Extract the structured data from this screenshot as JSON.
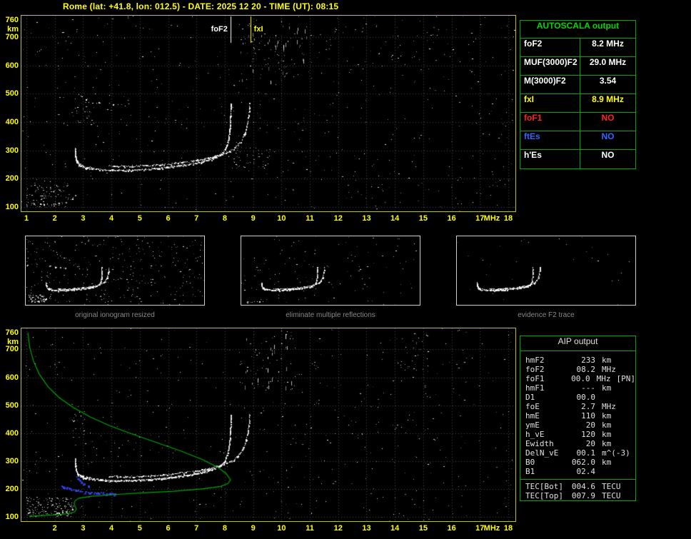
{
  "header": {
    "title": "Rome (lat: +41.8, lon: 012.5) - DATE: 2025 12 20 - TIME (UT): 08:15"
  },
  "colors": {
    "background": "#000000",
    "title_text": "#ffff00",
    "plot_frame": "#c0c020",
    "axis_labels": "#ffff00",
    "grid": "#4a4a4a",
    "trace": "#ffffff",
    "restored_trace": "#3344ee",
    "profile_line": "#00a800",
    "table_border": "#00aa00",
    "autoscala_title": "#00d800",
    "value_yellow": "#ffff00",
    "value_red": "#ff2222",
    "value_blue": "#3366ff",
    "caption_text": "#8a8a8a"
  },
  "autoscala": {
    "title": "AUTOSCALA output",
    "rows": [
      {
        "label": "foF2",
        "value": "8.2 MHz",
        "color": "#ffffff"
      },
      {
        "label": "MUF(3000)F2",
        "value": "29.0 MHz",
        "color": "#ffffff"
      },
      {
        "label": "M(3000)F2",
        "value": "3.54",
        "color": "#ffffff"
      },
      {
        "label": "fxI",
        "value": "8.9 MHz",
        "color": "#ffff00"
      },
      {
        "label": "foF1",
        "value": "NO",
        "color": "#ff2222"
      },
      {
        "label": "ftEs",
        "value": "NO",
        "color": "#3366ff"
      },
      {
        "label": "h'Es",
        "value": "NO",
        "color": "#ffffff"
      }
    ]
  },
  "aip": {
    "title": "AIP output",
    "rows": [
      {
        "label": "hmF2",
        "value": "233",
        "unit": "km",
        "note": ""
      },
      {
        "label": "foF2",
        "value": "08.2",
        "unit": "MHz",
        "note": ""
      },
      {
        "label": "foF1",
        "value": "00.0",
        "unit": "MHz",
        "note": "[PN]"
      },
      {
        "label": "hmF1",
        "value": "---",
        "unit": "km",
        "note": ""
      },
      {
        "label": "D1",
        "value": "00.0",
        "unit": "",
        "note": ""
      },
      {
        "label": "foE",
        "value": "2.7",
        "unit": "MHz",
        "note": ""
      },
      {
        "label": "hmE",
        "value": "110",
        "unit": "km",
        "note": ""
      },
      {
        "label": "ymE",
        "value": "20",
        "unit": "km",
        "note": ""
      },
      {
        "label": "h_vE",
        "value": "120",
        "unit": "km",
        "note": ""
      },
      {
        "label": "Ewidth",
        "value": "20",
        "unit": "km",
        "note": ""
      },
      {
        "label": "DelN_vE",
        "value": "00.1",
        "unit": "m^(-3)",
        "note": ""
      },
      {
        "label": "B0",
        "value": "062.0",
        "unit": "km",
        "note": ""
      },
      {
        "label": "B1",
        "value": "02.4",
        "unit": "",
        "note": ""
      }
    ],
    "tec_rows": [
      {
        "label": "TEC[Bot]",
        "value": "004.6",
        "unit": "TECU"
      },
      {
        "label": "TEC[Top]",
        "value": "007.9",
        "unit": "TECU"
      }
    ]
  },
  "thumbnails": [
    {
      "caption": "original ionogram resized",
      "noise": 340,
      "series": [
        0,
        1,
        2,
        3,
        4
      ],
      "seed": 11
    },
    {
      "caption": "eliminate multiple reflections",
      "noise": 120,
      "series": [
        0,
        1,
        2,
        3
      ],
      "seed": 12
    },
    {
      "caption": "evidence F2 trace",
      "noise": 28,
      "series": [
        1,
        2,
        3
      ],
      "seed": 13
    }
  ],
  "chart_data": [
    {
      "type": "scatter",
      "title": "ionogram with autoscaled characteristics",
      "xlabel": "MHz",
      "ylabel": "km",
      "xlim": [
        1,
        18
      ],
      "ylim": [
        100,
        760
      ],
      "x_ticks": [
        1,
        2,
        3,
        4,
        5,
        6,
        7,
        8,
        9,
        10,
        11,
        12,
        13,
        14,
        15,
        16,
        17,
        18
      ],
      "x_gridlines": [
        1,
        2,
        3,
        4,
        5,
        6,
        7,
        8,
        9,
        10,
        11,
        12,
        13,
        14,
        15,
        16,
        17,
        18
      ],
      "y_ticks": [
        760,
        700,
        600,
        500,
        400,
        300,
        200,
        100
      ],
      "y_gridlines": [
        100,
        200,
        300,
        400,
        500,
        600,
        700
      ],
      "grid": true,
      "noise": 560,
      "seed": 7,
      "noise_clusters": [
        {
          "x": [
            8.5,
            10.9
          ],
          "y": [
            540,
            760
          ],
          "n": 90,
          "streaks": true
        },
        {
          "x": [
            1.0,
            2.5
          ],
          "y": [
            100,
            185
          ],
          "n": 90
        },
        {
          "x": [
            8.3,
            9.6
          ],
          "y": [
            225,
            310
          ],
          "n": 45
        },
        {
          "x": [
            2.6,
            3.4
          ],
          "y": [
            390,
            520
          ],
          "n": 25
        },
        {
          "x": [
            11.0,
            16.8
          ],
          "y": [
            600,
            760
          ],
          "n": 40
        }
      ],
      "markers": [
        {
          "label": "foF2",
          "freq": 8.2,
          "color": "#ffffff",
          "label_side": "left",
          "line_length": 38
        },
        {
          "label": "fxI",
          "freq": 8.9,
          "color": "#ffff00",
          "label_side": "right",
          "line_length": 38
        }
      ],
      "series": [
        {
          "name": "E-trace",
          "color": "#ffffff",
          "density": 0.5,
          "keep": 0.55,
          "jitter": 1.2,
          "points": [
            [
              1.05,
              118
            ],
            [
              1.3,
              113
            ],
            [
              1.6,
              111
            ],
            [
              1.95,
              112
            ],
            [
              2.25,
              115
            ],
            [
              2.5,
              121
            ],
            [
              2.62,
              130
            ],
            [
              2.7,
              142
            ]
          ]
        },
        {
          "name": "F-cusp",
          "color": "#ffffff",
          "density": 3,
          "keep": 0.95,
          "jitter": 2.2,
          "points": [
            [
              2.7,
              305
            ],
            [
              2.72,
              283
            ],
            [
              2.76,
              262
            ],
            [
              2.84,
              250
            ],
            [
              3.0,
              243
            ],
            [
              3.25,
              238
            ]
          ]
        },
        {
          "name": "F2-ordinary-trace",
          "color": "#ffffff",
          "density": 1.6,
          "keep": 0.93,
          "jitter": 1.1,
          "points": [
            [
              3.25,
              238
            ],
            [
              3.7,
              232
            ],
            [
              4.2,
              230
            ],
            [
              4.8,
              231
            ],
            [
              5.4,
              235
            ],
            [
              6.0,
              241
            ],
            [
              6.6,
              249
            ],
            [
              7.1,
              258
            ],
            [
              7.5,
              269
            ],
            [
              7.8,
              283
            ],
            [
              8.0,
              302
            ],
            [
              8.1,
              330
            ],
            [
              8.16,
              368
            ],
            [
              8.19,
              420
            ],
            [
              8.2,
              468
            ]
          ]
        },
        {
          "name": "F2-extraordinary-trace",
          "color": "#ffffff",
          "density": 1.3,
          "keep": 0.9,
          "jitter": 1.1,
          "points": [
            [
              3.9,
              247
            ],
            [
              4.5,
              244
            ],
            [
              5.1,
              246
            ],
            [
              5.7,
              250
            ],
            [
              6.3,
              256
            ],
            [
              6.9,
              264
            ],
            [
              7.4,
              273
            ],
            [
              7.9,
              287
            ],
            [
              8.3,
              305
            ],
            [
              8.55,
              330
            ],
            [
              8.7,
              360
            ],
            [
              8.8,
              400
            ],
            [
              8.85,
              440
            ],
            [
              8.87,
              468
            ]
          ]
        },
        {
          "name": "second-hop-multiple",
          "color": "#ffffff",
          "density": 0.5,
          "keep": 0.45,
          "jitter": 1.6,
          "points": [
            [
              2.85,
              495
            ],
            [
              3.2,
              474
            ],
            [
              3.6,
              466
            ],
            [
              4.1,
              462
            ],
            [
              4.6,
              463
            ]
          ]
        }
      ]
    },
    {
      "type": "scatter",
      "title": "restored ionogram with electron density profile",
      "xlabel": "MHz",
      "ylabel": "km",
      "xlim": [
        1,
        18
      ],
      "ylim": [
        100,
        760
      ],
      "x_ticks": [
        2,
        3,
        4,
        5,
        6,
        7,
        8,
        9,
        10,
        11,
        12,
        13,
        14,
        15,
        16,
        17,
        18
      ],
      "x_gridlines": [
        1,
        2,
        3,
        4,
        5,
        6,
        7,
        8,
        9,
        10,
        11,
        12,
        13,
        14,
        15,
        16,
        17,
        18
      ],
      "y_ticks": [
        760,
        700,
        600,
        500,
        400,
        300,
        200,
        100
      ],
      "y_gridlines": [
        100,
        200,
        300,
        400,
        500,
        600,
        700
      ],
      "grid": true,
      "noise": 520,
      "seed": 21,
      "noise_clusters": [
        {
          "x": [
            1.0,
            2.6
          ],
          "y": [
            100,
            172
          ],
          "n": 150
        },
        {
          "x": [
            8.5,
            10.6
          ],
          "y": [
            560,
            760
          ],
          "n": 55,
          "streaks": true
        },
        {
          "x": [
            2.6,
            3.1
          ],
          "y": [
            380,
            480
          ],
          "n": 18
        },
        {
          "x": [
            14.2,
            15.3
          ],
          "y": [
            620,
            760
          ],
          "n": 20
        }
      ],
      "markers": [],
      "series": [
        {
          "name": "E-trace",
          "color": "#ffffff",
          "density": 0.5,
          "keep": 0.55,
          "jitter": 1.2,
          "points": [
            [
              1.05,
              118
            ],
            [
              1.3,
              113
            ],
            [
              1.6,
              111
            ],
            [
              1.95,
              112
            ],
            [
              2.25,
              115
            ],
            [
              2.5,
              121
            ],
            [
              2.62,
              130
            ],
            [
              2.7,
              142
            ]
          ]
        },
        {
          "name": "F-cusp",
          "color": "#ffffff",
          "density": 3,
          "keep": 0.95,
          "jitter": 2.2,
          "points": [
            [
              2.7,
              305
            ],
            [
              2.72,
              283
            ],
            [
              2.76,
              262
            ],
            [
              2.84,
              250
            ],
            [
              3.0,
              243
            ],
            [
              3.25,
              238
            ]
          ]
        },
        {
          "name": "F2-ordinary-trace",
          "color": "#ffffff",
          "density": 2,
          "keep": 0.95,
          "jitter": 1.1,
          "points": [
            [
              3.25,
              238
            ],
            [
              3.7,
              232
            ],
            [
              4.2,
              230
            ],
            [
              4.8,
              231
            ],
            [
              5.4,
              235
            ],
            [
              6.0,
              241
            ],
            [
              6.6,
              249
            ],
            [
              7.1,
              258
            ],
            [
              7.5,
              269
            ],
            [
              7.8,
              283
            ],
            [
              8.0,
              302
            ],
            [
              8.1,
              330
            ],
            [
              8.16,
              368
            ],
            [
              8.19,
              420
            ],
            [
              8.2,
              468
            ]
          ]
        },
        {
          "name": "F2-extraordinary-trace",
          "color": "#ffffff",
          "density": 1.3,
          "keep": 0.9,
          "jitter": 1.1,
          "points": [
            [
              3.9,
              247
            ],
            [
              4.5,
              244
            ],
            [
              5.1,
              246
            ],
            [
              5.7,
              250
            ],
            [
              6.3,
              256
            ],
            [
              6.9,
              264
            ],
            [
              7.4,
              273
            ],
            [
              7.9,
              287
            ],
            [
              8.3,
              305
            ],
            [
              8.55,
              330
            ],
            [
              8.7,
              360
            ],
            [
              8.8,
              400
            ],
            [
              8.85,
              440
            ],
            [
              8.87,
              468
            ]
          ]
        },
        {
          "name": "restored-trace-blue",
          "color": "#3344ee",
          "density": 1.1,
          "keep": 0.8,
          "jitter": 1.3,
          "size": 2,
          "points": [
            [
              2.2,
              212
            ],
            [
              2.55,
              201
            ],
            [
              2.9,
              193
            ],
            [
              3.3,
              188
            ],
            [
              3.7,
              185
            ],
            [
              4.1,
              183
            ]
          ]
        },
        {
          "name": "restored-cusp-blue",
          "color": "#3344ee",
          "density": 1.0,
          "keep": 0.7,
          "jitter": 1.4,
          "size": 2,
          "points": [
            [
              2.72,
              262
            ],
            [
              2.78,
              240
            ],
            [
              2.95,
              222
            ],
            [
              3.2,
              210
            ]
          ]
        },
        {
          "name": "electron-density-profile",
          "style": "line",
          "color": "#00a800",
          "points": [
            [
              1.05,
              760
            ],
            [
              1.12,
              706
            ],
            [
              1.25,
              658
            ],
            [
              1.45,
              612
            ],
            [
              1.75,
              568
            ],
            [
              2.15,
              528
            ],
            [
              2.65,
              492
            ],
            [
              3.25,
              458
            ],
            [
              3.95,
              426
            ],
            [
              4.75,
              396
            ],
            [
              5.6,
              366
            ],
            [
              6.45,
              336
            ],
            [
              7.2,
              306
            ],
            [
              7.75,
              278
            ],
            [
              8.05,
              255
            ],
            [
              8.2,
              233
            ],
            [
              8.12,
              220
            ],
            [
              7.85,
              209
            ],
            [
              7.2,
              200
            ],
            [
              6.2,
              192
            ],
            [
              5.1,
              186
            ],
            [
              4.1,
              180
            ],
            [
              3.3,
              174
            ],
            [
              2.85,
              167
            ],
            [
              2.72,
              158
            ],
            [
              2.68,
              148
            ],
            [
              2.72,
              138
            ],
            [
              2.76,
              128
            ],
            [
              2.7,
              118
            ],
            [
              2.45,
              111
            ],
            [
              2.0,
              107
            ],
            [
              1.5,
              104
            ],
            [
              1.1,
              102
            ]
          ]
        }
      ]
    }
  ]
}
